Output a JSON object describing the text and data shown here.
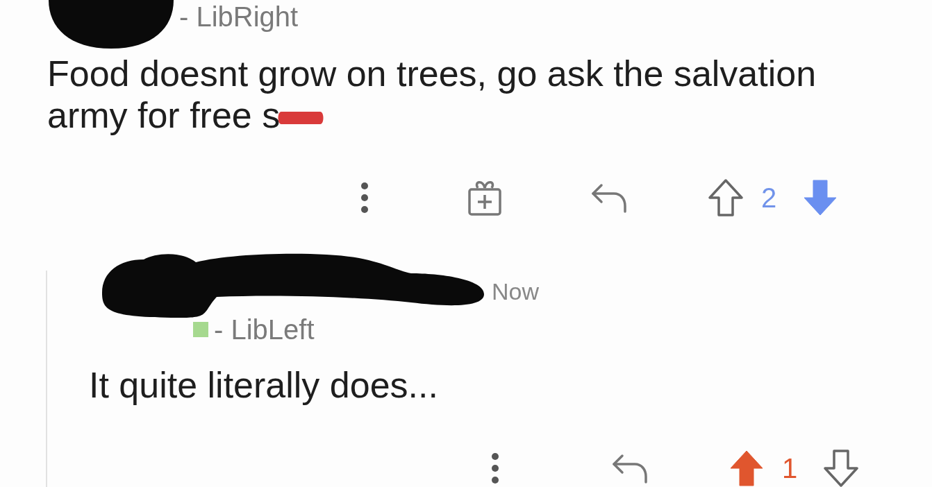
{
  "comments": [
    {
      "kind": "comment",
      "flair": "- LibRight",
      "body": "Food doesnt grow on trees, go ask the salvation army for free s",
      "censored": true,
      "gift": true,
      "score": "2",
      "upvoted": false,
      "downvoted": true
    },
    {
      "kind": "reply",
      "flair": "- LibLeft",
      "color": "#a6d98f",
      "time": "Now",
      "body": "It quite literally does...",
      "score": "1",
      "upvoted": true,
      "downvoted": false
    }
  ]
}
